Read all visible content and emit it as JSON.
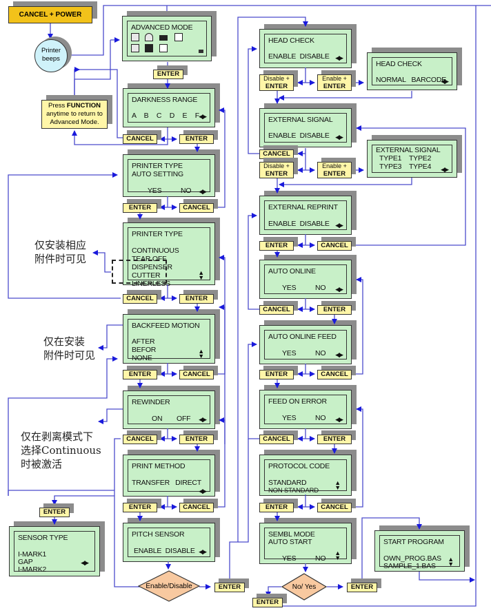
{
  "start": {
    "label": "CANCEL + POWER"
  },
  "beep": {
    "line1": "Printer",
    "line2": "beeps"
  },
  "note": {
    "line1": "Press",
    "bold": "FUNCTION",
    "line2": "anytime to return to",
    "line3": "Advanced Mode."
  },
  "buttons": {
    "enter": "ENTER",
    "cancel": "CANCEL",
    "disable_enter_top": "Disable +",
    "enable_enter_top": "Enable +",
    "enter_bottom": "ENTER"
  },
  "screens": {
    "advanced": {
      "title": "ADVANCED MODE"
    },
    "darkness": {
      "title": "DARKNESS RANGE",
      "options": "A  B  C  D  E  F"
    },
    "printer_auto": {
      "title": "PRINTER TYPE",
      "line2": "AUTO SETTING",
      "yes": "YES",
      "no": "NO"
    },
    "printer_type": {
      "title": "PRINTER TYPE",
      "options": [
        "CONTINUOUS",
        "TEAR OFF",
        "DISPENSER",
        "CUTTER",
        "LINERLESS"
      ]
    },
    "backfeed": {
      "title": "BACKFEED MOTION",
      "options": [
        "AFTER",
        "BEFOR",
        "NONE"
      ]
    },
    "rewinder": {
      "title": "REWINDER",
      "on": "ON",
      "off": "OFF"
    },
    "print_method": {
      "title": "PRINT METHOD",
      "options": "TRANSFER   DIRECT"
    },
    "pitch_sensor": {
      "title": "PITCH SENSOR",
      "options": "ENABLE  DISABLE"
    },
    "sensor_type": {
      "title": "SENSOR TYPE",
      "options": [
        "I-MARK1",
        "GAP",
        "I-MARK2"
      ]
    },
    "head_check": {
      "title": "HEAD CHECK",
      "options": "ENABLE  DISABLE"
    },
    "head_check2": {
      "title": "HEAD CHECK",
      "options": "NORMAL   BARCODE"
    },
    "ext_signal": {
      "title": "EXTERNAL SIGNAL",
      "options": "ENABLE  DISABLE"
    },
    "ext_signal2": {
      "title": "EXTERNAL SIGNAL",
      "row1": "TYPE1    TYPE2",
      "row2": "TYPE3    TYPE4"
    },
    "ext_reprint": {
      "title": "EXTERNAL REPRINT",
      "options": "ENABLE  DISABLE"
    },
    "auto_online": {
      "title": "AUTO ONLINE",
      "yes": "YES",
      "no": "NO"
    },
    "auto_online_feed": {
      "title": "AUTO ONLINE FEED",
      "yes": "YES",
      "no": "NO"
    },
    "feed_on_error": {
      "title": "FEED ON ERROR",
      "yes": "YES",
      "no": "NO"
    },
    "protocol": {
      "title": "PROTOCOL CODE",
      "options": [
        "STANDARD",
        "NON STANDARD"
      ]
    },
    "sembl": {
      "title": "SEMBL MODE",
      "line2": "AUTO START",
      "yes": "YES",
      "no": "NO"
    },
    "start_program": {
      "title": "START PROGRAM",
      "options": [
        "OWN_PROG.BAS",
        "SAMPLE_1.BAS"
      ]
    }
  },
  "decisions": {
    "enable_disable": "Enable/Disable",
    "no_yes": "No/ Yes"
  },
  "notes_cn": {
    "accessory1": [
      "仅安装相应",
      "附件时可见"
    ],
    "accessory2": [
      "仅在安装",
      "附件时可见"
    ],
    "peel": [
      "仅在剥离模式下",
      "选择Continuous",
      "时被激活"
    ]
  },
  "colors": {
    "lcd": "#c8f0c8",
    "button": "#fff6a8",
    "start": "#f2c21a",
    "line": "#1a1adc",
    "diamond": "#f8c9a0",
    "circle": "#cff2fa"
  }
}
